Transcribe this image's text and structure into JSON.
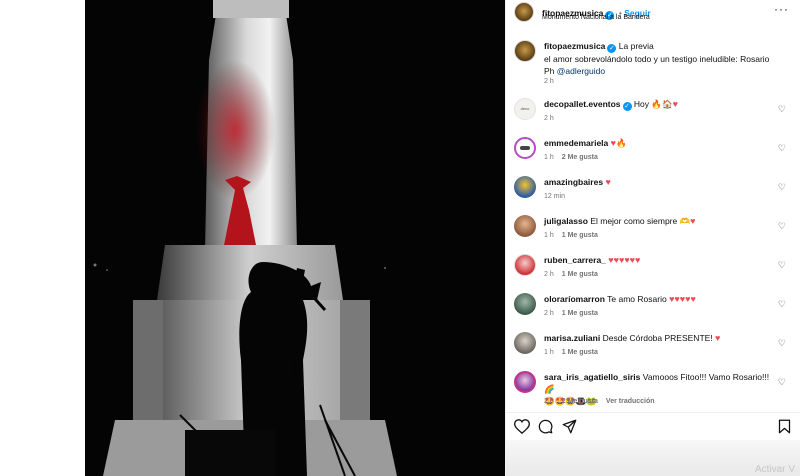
{
  "post": {
    "author": "fitopaezmusica",
    "follow_label": "Seguir",
    "location": "Monumento Nacional a la Bandera",
    "caption_line1": "La previa",
    "caption_line2": "el amor sobrevolándolo todo y un testigo ineludible: Rosario",
    "caption_line3_prefix": "Ph",
    "caption_mention": "@adlerguido",
    "caption_time": "2 h",
    "more": "···"
  },
  "comments": [
    {
      "user": "decopallet.eventos",
      "text": "Hoy",
      "emoji": "🔥🏠",
      "hearts": "♥",
      "time": "2 h",
      "likes": "",
      "extra": ""
    },
    {
      "user": "emmedemariela",
      "text": "",
      "emoji": "🔥",
      "hearts": "♥",
      "time": "1 h",
      "likes": "2 Me gusta",
      "extra": ""
    },
    {
      "user": "amazingbaires",
      "text": "",
      "emoji": "",
      "hearts": "♥",
      "time": "12 min",
      "likes": "",
      "extra": ""
    },
    {
      "user": "juligalasso",
      "text": "El mejor como siempre 🫶",
      "emoji": "",
      "hearts": "♥",
      "time": "1 h",
      "likes": "1 Me gusta",
      "extra": ""
    },
    {
      "user": "ruben_carrera_",
      "text": "",
      "emoji": "",
      "hearts": "♥♥♥♥♥♥",
      "time": "2 h",
      "likes": "1 Me gusta",
      "extra": ""
    },
    {
      "user": "oloraríomarron",
      "text": "Te amo Rosario",
      "emoji": "",
      "hearts": "♥♥♥♥♥",
      "time": "2 h",
      "likes": "1 Me gusta",
      "extra": ""
    },
    {
      "user": "marisa.zuliani",
      "text": "Desde Córdoba PRESENTE!",
      "emoji": "",
      "hearts": "♥",
      "time": "1 h",
      "likes": "1 Me gusta",
      "extra": ""
    },
    {
      "user": "sara_iris_agatiello_siris",
      "text": "Vamooos Fitoo!!! Vamo Rosario!!!",
      "emoji": "🌈",
      "hearts": "",
      "line2": "🤩🤩🤩🎩🐸",
      "time": "2 h",
      "likes": "2 Me gusta",
      "extra": "Ver traducción"
    }
  ],
  "watermark": "Activar V",
  "colors": {
    "accent": "#0095f6",
    "heart": "#ed4956",
    "meta": "#737373"
  }
}
